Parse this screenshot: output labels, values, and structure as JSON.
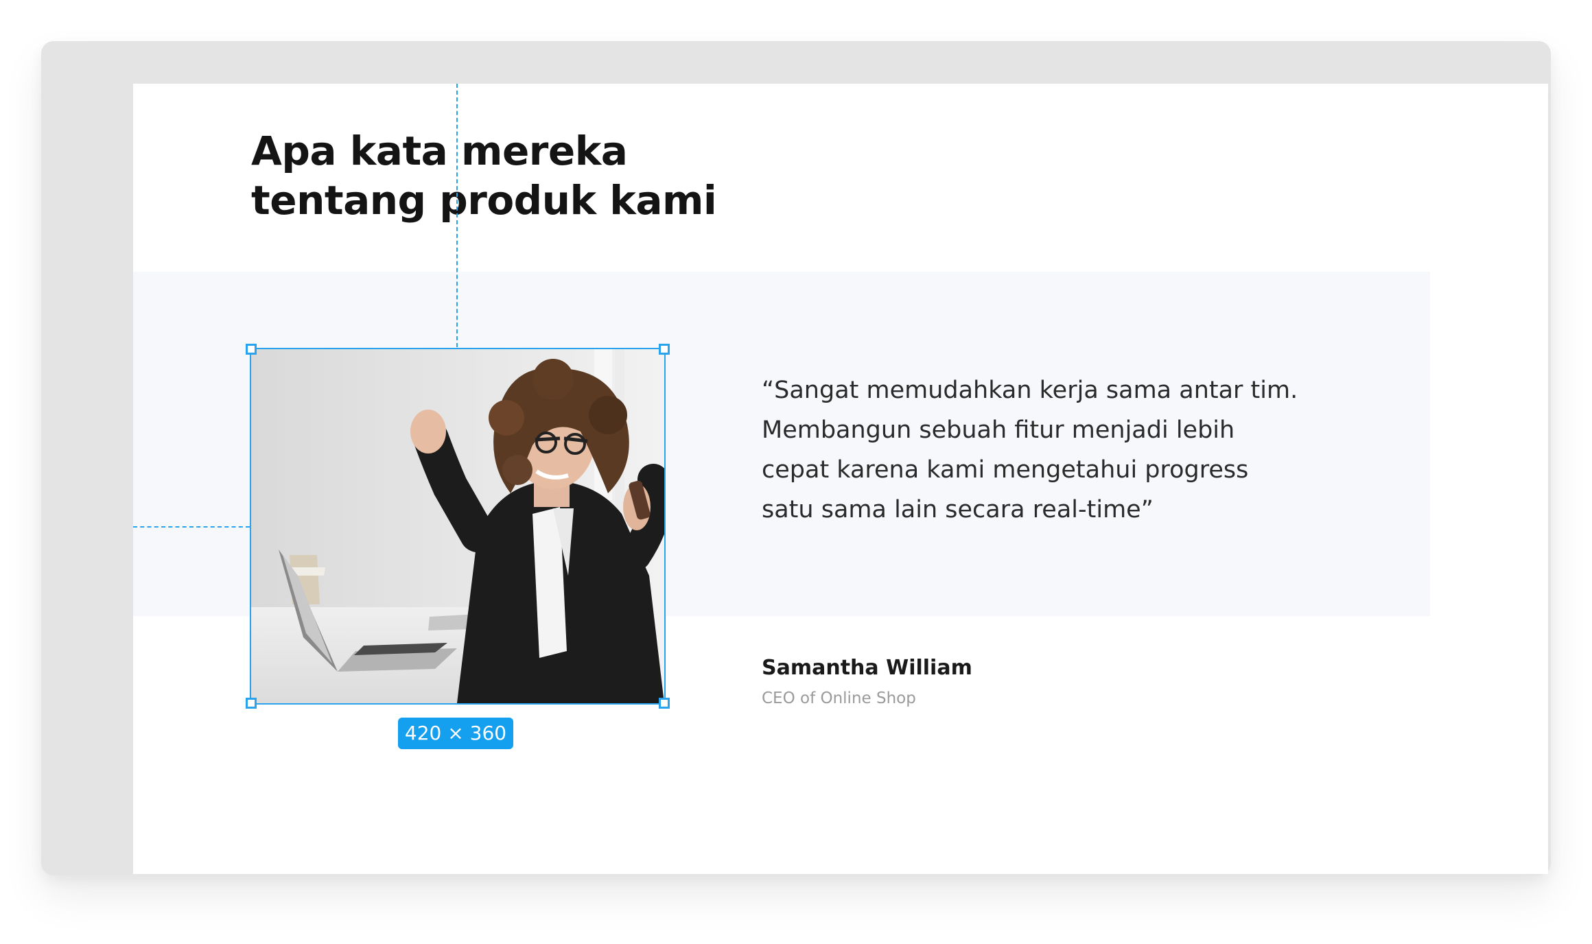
{
  "section": {
    "heading_line1": "Apa kata mereka",
    "heading_line2": "tentang produk kami"
  },
  "testimonial": {
    "quote_lines": [
      "“Sangat memudahkan kerja sama antar tim.",
      "Membangun sebuah fitur menjadi lebih",
      "cepat karena kami mengetahui progress",
      "satu sama lain secara real-time”"
    ],
    "author_name": "Samantha William",
    "author_role": "CEO of Online Shop"
  },
  "selection": {
    "size_label": "420 × 360"
  },
  "colors": {
    "accent": "#14a0ee",
    "band_bg": "#f6f8fc",
    "frame_bg": "#e4e4e4",
    "heading": "#141414"
  },
  "icons": {
    "resize_handle": "resize-handle-icon"
  }
}
